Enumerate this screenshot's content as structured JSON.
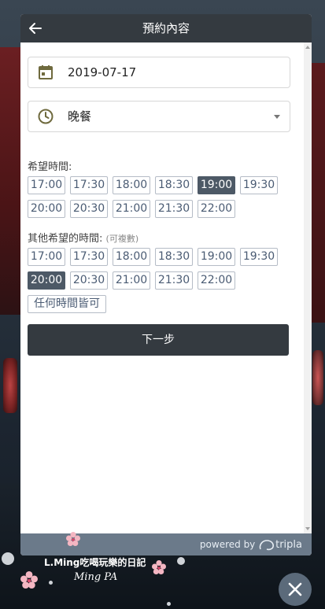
{
  "header": {
    "title": "預約內容"
  },
  "date_field": {
    "value": "2019-07-17",
    "icon": "calendar-icon"
  },
  "meal_field": {
    "value": "晚餐",
    "icon": "clock-icon"
  },
  "preferred": {
    "label": "希望時間:",
    "times": [
      "17:00",
      "17:30",
      "18:00",
      "18:30",
      "19:00",
      "19:30",
      "20:00",
      "20:30",
      "21:00",
      "21:30",
      "22:00"
    ],
    "selected": "19:00"
  },
  "other": {
    "label": "其他希望的時間:",
    "hint": "(可複數)",
    "times": [
      "17:00",
      "17:30",
      "18:00",
      "18:30",
      "19:00",
      "19:30",
      "20:00",
      "20:30",
      "21:00",
      "21:30",
      "22:00"
    ],
    "selected": "20:00",
    "any_label": "任何時間皆可"
  },
  "next_button": {
    "label": "下一步"
  },
  "footer": {
    "powered": "powered by",
    "brand": "tripla"
  },
  "watermark": {
    "line1": "L.Ming吃喝玩樂的日記",
    "line2": "Ming PA"
  },
  "colors": {
    "header": "#343a40",
    "selected": "#4d5966",
    "slot_text": "#4a5b73",
    "footer": "#6b7a8a"
  }
}
